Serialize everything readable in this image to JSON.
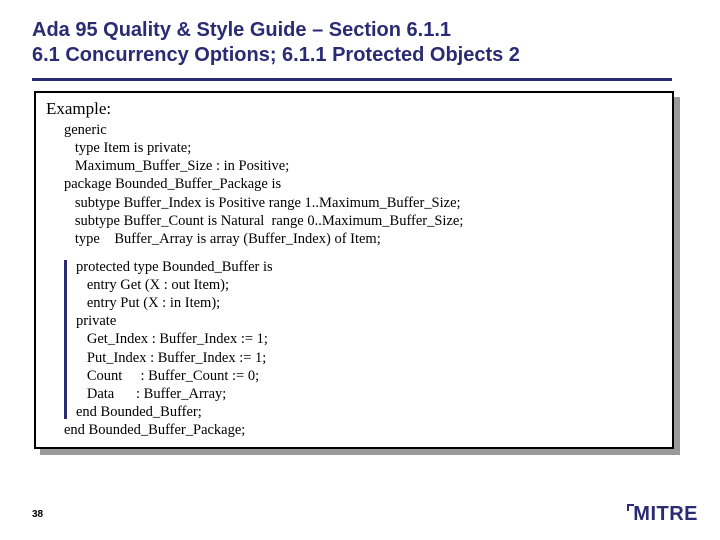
{
  "title_line1": "Ada 95 Quality & Style Guide – Section 6.1.1",
  "title_line2": "6.1 Concurrency Options; 6.1.1 Protected Objects 2",
  "example_label": "Example:",
  "code_block1": "generic\n   type Item is private;\n   Maximum_Buffer_Size : in Positive;\npackage Bounded_Buffer_Package is\n   subtype Buffer_Index is Positive range 1..Maximum_Buffer_Size;\n   subtype Buffer_Count is Natural  range 0..Maximum_Buffer_Size;\n   type    Buffer_Array is array (Buffer_Index) of Item;",
  "code_block2": "protected type Bounded_Buffer is\n   entry Get (X : out Item);\n   entry Put (X : in Item);\nprivate\n   Get_Index : Buffer_Index := 1;\n   Put_Index : Buffer_Index := 1;\n   Count     : Buffer_Count := 0;\n   Data      : Buffer_Array;\nend Bounded_Buffer;",
  "code_end": "end Bounded_Buffer_Package;",
  "page_number": "38",
  "logo_text": "MITRE"
}
